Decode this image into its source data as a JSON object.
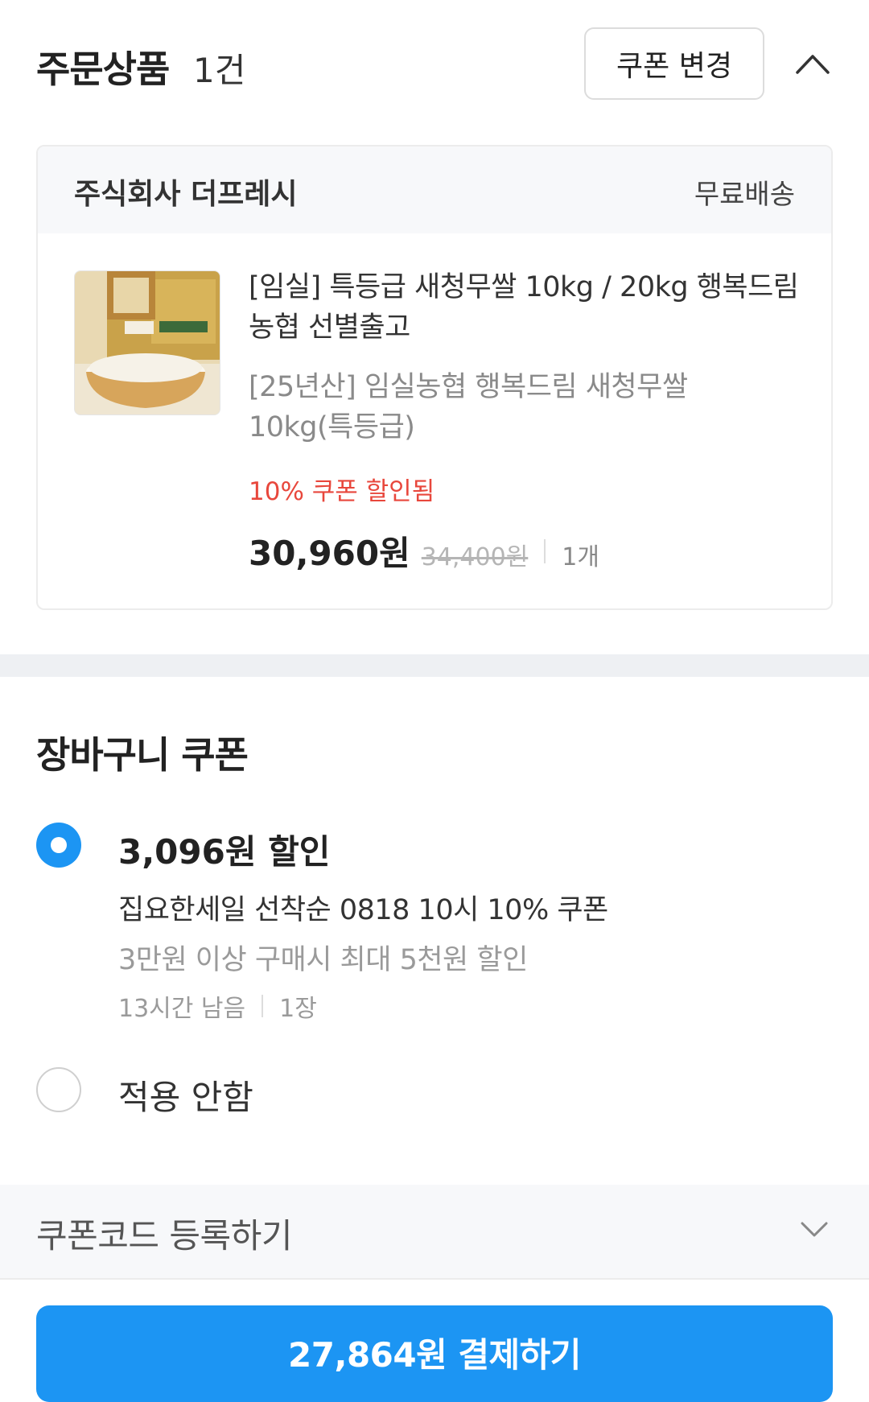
{
  "order": {
    "title": "주문상품",
    "count": "1건",
    "coupon_change_label": "쿠폰 변경",
    "collapse_icon": "chevron-up-icon"
  },
  "seller": {
    "name": "주식회사 더프레시",
    "shipping": "무료배송"
  },
  "product": {
    "thumbnail_icon": "rice-product-image",
    "name": "[임실] 특등급 새청무쌀 10kg / 20kg 행복드림 농협 선별출고",
    "option": "[25년산] 임실농협 행복드림 새청무쌀 10kg(특등급)",
    "coupon_applied": "10% 쿠폰 할인됨",
    "price": "30,960원",
    "original_price": "34,400원",
    "quantity": "1개"
  },
  "cart_coupon": {
    "title": "장바구니 쿠폰",
    "options": [
      {
        "selected": true,
        "amount": "3,096원 할인",
        "name": "집요한세일 선착순 0818 10시 10% 쿠폰",
        "condition": "3만원 이상 구매시 최대 5천원 할인",
        "time_left": "13시간 남음",
        "count": "1장"
      },
      {
        "selected": false,
        "label": "적용 안함"
      }
    ]
  },
  "coupon_code": {
    "label": "쿠폰코드 등록하기",
    "icon": "chevron-down-icon"
  },
  "pay_button": {
    "label": "27,864원 결제하기"
  },
  "colors": {
    "accent": "#1c95f3",
    "discount_red": "#e8473c",
    "section_gray": "#eef0f3"
  }
}
